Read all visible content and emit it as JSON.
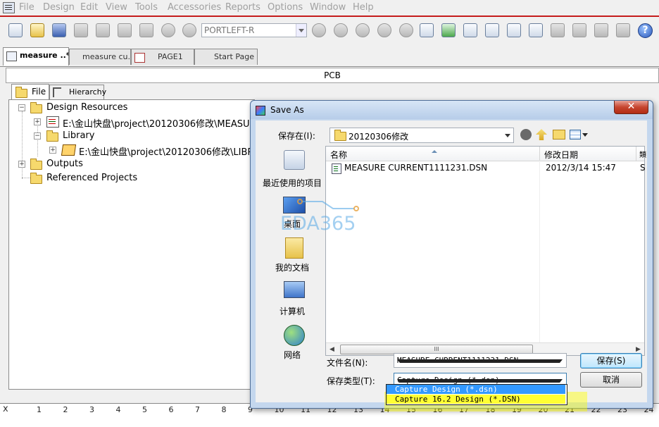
{
  "menu": [
    "File",
    "Design",
    "Edit",
    "View",
    "Tools",
    "Accessories",
    "Reports",
    "Options",
    "Window",
    "Help"
  ],
  "toolbar": {
    "part_combo": "PORTLEFT-R",
    "help_glyph": "?"
  },
  "doc_tabs": [
    "measure ..*",
    "measure cu...",
    "PAGE1",
    "Start Page"
  ],
  "pcb_header": "PCB",
  "project_tabs": {
    "file": "File",
    "hierarchy": "Hierarchy"
  },
  "tree": {
    "design_resources": "Design Resources",
    "design_file": "E:\\金山快盘\\project\\20120306修改\\MEASURE C",
    "library": "Library",
    "library_file": "E:\\金山快盘\\project\\20120306修改\\LIBRARY",
    "outputs": "Outputs",
    "referenced": "Referenced Projects"
  },
  "dialog": {
    "title": "Save As",
    "close": "✕",
    "look_in_label": "保存在(I):",
    "look_in_value": "20120306修改",
    "places": [
      "最近使用的项目",
      "桌面",
      "我的文档",
      "计算机",
      "网络"
    ],
    "columns": {
      "name": "名称",
      "date": "修改日期",
      "more": "類"
    },
    "files": [
      {
        "name": "MEASURE CURRENT1111231.DSN",
        "date": "2012/3/14 15:47",
        "more": "S"
      }
    ],
    "scroll_thumb": "III",
    "filename_label": "文件名(N):",
    "filename_value": "MEASURE CURRENT1111231.DSN",
    "filetype_label": "保存类型(T):",
    "filetype_value": "Capture Design (*.dsn)",
    "filetype_options": [
      "Capture Design (*.dsn)",
      "Capture 16.2 Design (*.DSN)"
    ],
    "save_button": "保存(S)",
    "cancel_button": "取消"
  },
  "ruler": {
    "marks": [
      "1",
      "2",
      "3",
      "4",
      "5",
      "6",
      "7",
      "8",
      "9",
      "10",
      "11",
      "12",
      "13",
      "14",
      "15",
      "16",
      "17",
      "18",
      "19",
      "20",
      "21",
      "22",
      "23",
      "24"
    ]
  },
  "watermark": "EDA365",
  "colors": {
    "accent_red": "#c51b1b",
    "selection_blue": "#3399ff",
    "highlight_yellow": "#ffff33"
  }
}
